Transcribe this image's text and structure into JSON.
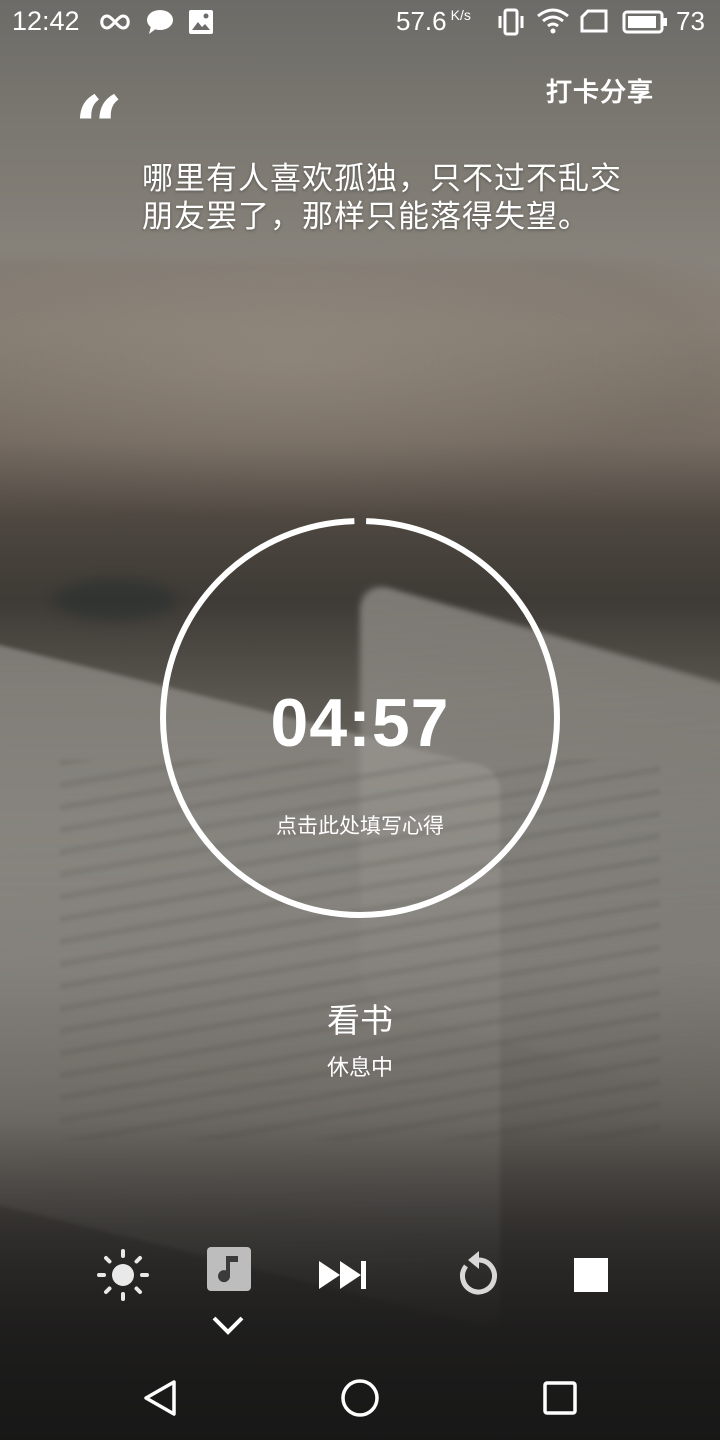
{
  "status_bar": {
    "time": "12:42",
    "icons_left": [
      "infinity-icon",
      "chat-bubble-icon",
      "image-icon"
    ],
    "speed": "57.6",
    "speed_unit": "K/s",
    "icons_right": [
      "vibrate-icon",
      "wifi-icon",
      "sim-card-icon",
      "battery-icon"
    ],
    "battery_percent": "73"
  },
  "header": {
    "share_label": "打卡分享"
  },
  "quote": {
    "mark": "“",
    "text": "哪里有人喜欢孤独，只不过不乱交朋友罢了，那样只能落得失望。"
  },
  "timer": {
    "time": "04:57",
    "note": "点击此处填写心得",
    "progress_fraction": 0.99
  },
  "task": {
    "name": "看书",
    "status": "休息中"
  },
  "controls": [
    "brightness-icon",
    "music-note-icon",
    "skip-next-icon",
    "restart-icon",
    "stop-icon",
    "chevron-down-icon"
  ],
  "nav": [
    "back-icon",
    "home-icon",
    "recents-icon"
  ],
  "colors": {
    "foreground": "#ffffff",
    "ring": "#ffffff"
  }
}
